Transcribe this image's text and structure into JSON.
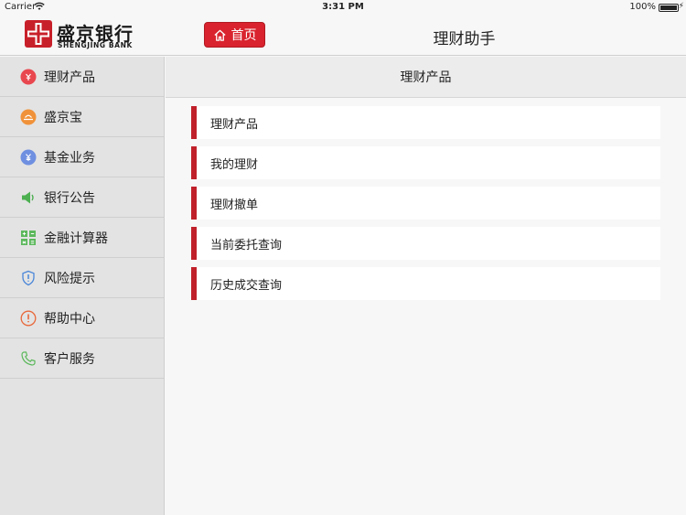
{
  "status_bar": {
    "carrier": "Carrier",
    "time": "3:31 PM",
    "battery": "100%"
  },
  "header": {
    "logo_cn": "盛京银行",
    "logo_en": "SHENGJING BANK",
    "home_button": "首页",
    "title": "理财助手"
  },
  "sidebar": {
    "items": [
      {
        "label": "理财产品",
        "icon": "wealth-icon"
      },
      {
        "label": "盛京宝",
        "icon": "shengjingbao-icon"
      },
      {
        "label": "基金业务",
        "icon": "fund-icon"
      },
      {
        "label": "银行公告",
        "icon": "speaker-icon"
      },
      {
        "label": "金融计算器",
        "icon": "calculator-icon"
      },
      {
        "label": "风险提示",
        "icon": "shield-icon"
      },
      {
        "label": "帮助中心",
        "icon": "help-icon"
      },
      {
        "label": "客户服务",
        "icon": "phone-icon"
      }
    ]
  },
  "main": {
    "header": "理财产品",
    "items": [
      {
        "label": "理财产品"
      },
      {
        "label": "我的理财"
      },
      {
        "label": "理财撤单"
      },
      {
        "label": "当前委托查询"
      },
      {
        "label": "历史成交查询"
      }
    ]
  },
  "colors": {
    "brand_red": "#d9232e",
    "accent_bar": "#c0202a",
    "sidebar_bg": "#e3e3e3"
  }
}
